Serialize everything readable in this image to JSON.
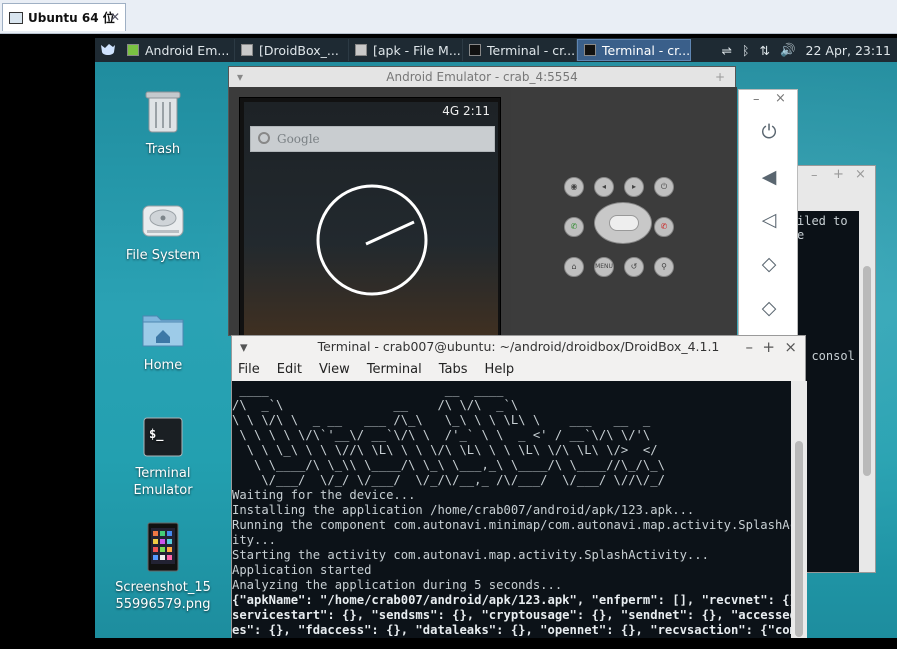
{
  "vm": {
    "tab_title": "Ubuntu 64 位",
    "tab_close": "✕"
  },
  "panel": {
    "tasks": [
      {
        "label": "Android Em...",
        "active": false
      },
      {
        "label": "[DroidBox_...",
        "active": false
      },
      {
        "label": "[apk - File M...",
        "active": false
      },
      {
        "label": "Terminal - cr...",
        "active": false
      },
      {
        "label": "Terminal - cr...",
        "active": true
      }
    ],
    "clock": "22 Apr, 23:11"
  },
  "desktop_icons": [
    {
      "label": "Trash",
      "icon": "trash-icon"
    },
    {
      "label": "File System",
      "icon": "drive-icon"
    },
    {
      "label": "Home",
      "icon": "home-folder-icon"
    },
    {
      "label": "Terminal\nEmulator",
      "icon": "terminal-icon"
    },
    {
      "label": "Screenshot_15\n55996579.png",
      "icon": "image-file-icon"
    }
  ],
  "emulator": {
    "title": "Android Emulator - crab_4:5554",
    "status": "4G  2:11",
    "search_placeholder": "Google"
  },
  "back_terminal": {
    "lines": [
      "iled to e",
      "",
      "",
      "",
      "",
      "",
      "",
      "",
      "",
      "r consol"
    ]
  },
  "terminal": {
    "title": "Terminal - crab007@ubuntu: ~/android/droidbox/DroidBox_4.1.1",
    "menu": [
      "File",
      "Edit",
      "View",
      "Terminal",
      "Tabs",
      "Help"
    ],
    "banner": [
      " ____                        __  ____",
      "/\\  _`\\               __    /\\ \\/\\  _`\\",
      "\\ \\ \\/\\ \\  _ __   ___ /\\_\\   \\_\\ \\ \\ \\L\\ \\    ___   __  _",
      " \\ \\ \\ \\ \\/\\`'__\\/ __`\\/\\ \\  /'_` \\ \\  _ <' / __`\\/\\ \\/'\\",
      "  \\ \\ \\_\\ \\ \\ \\//\\ \\L\\ \\ \\ \\/\\ \\L\\ \\ \\ \\L\\ \\/\\ \\L\\ \\/>  </",
      "   \\ \\____/\\ \\_\\\\ \\____/\\ \\_\\ \\___,_\\ \\____/\\ \\____//\\_/\\_\\",
      "    \\/___/  \\/_/ \\/___/  \\/_/\\/__,_ /\\/___/  \\/___/ \\//\\/_/"
    ],
    "lines": [
      "Waiting for the device...",
      "Installing the application /home/crab007/android/apk/123.apk...",
      "Running the component com.autonavi.minimap/com.autonavi.map.activity.SplashActiv",
      "ity...",
      "Starting the activity com.autonavi.map.activity.SplashActivity...",
      "Application started",
      "Analyzing the application during 5 seconds..."
    ],
    "json_lines": [
      "{\"apkName\": \"/home/crab007/android/apk/123.apk\", \"enfperm\": [], \"recvnet\": {}, \"",
      "servicestart\": {}, \"sendsms\": {}, \"cryptousage\": {}, \"sendnet\": {}, \"accessedfil",
      "es\": {}, \"fdaccess\": {}, \"dataleaks\": {}, \"opennet\": {}, \"recvsaction\": {\"com.ta"
    ]
  }
}
